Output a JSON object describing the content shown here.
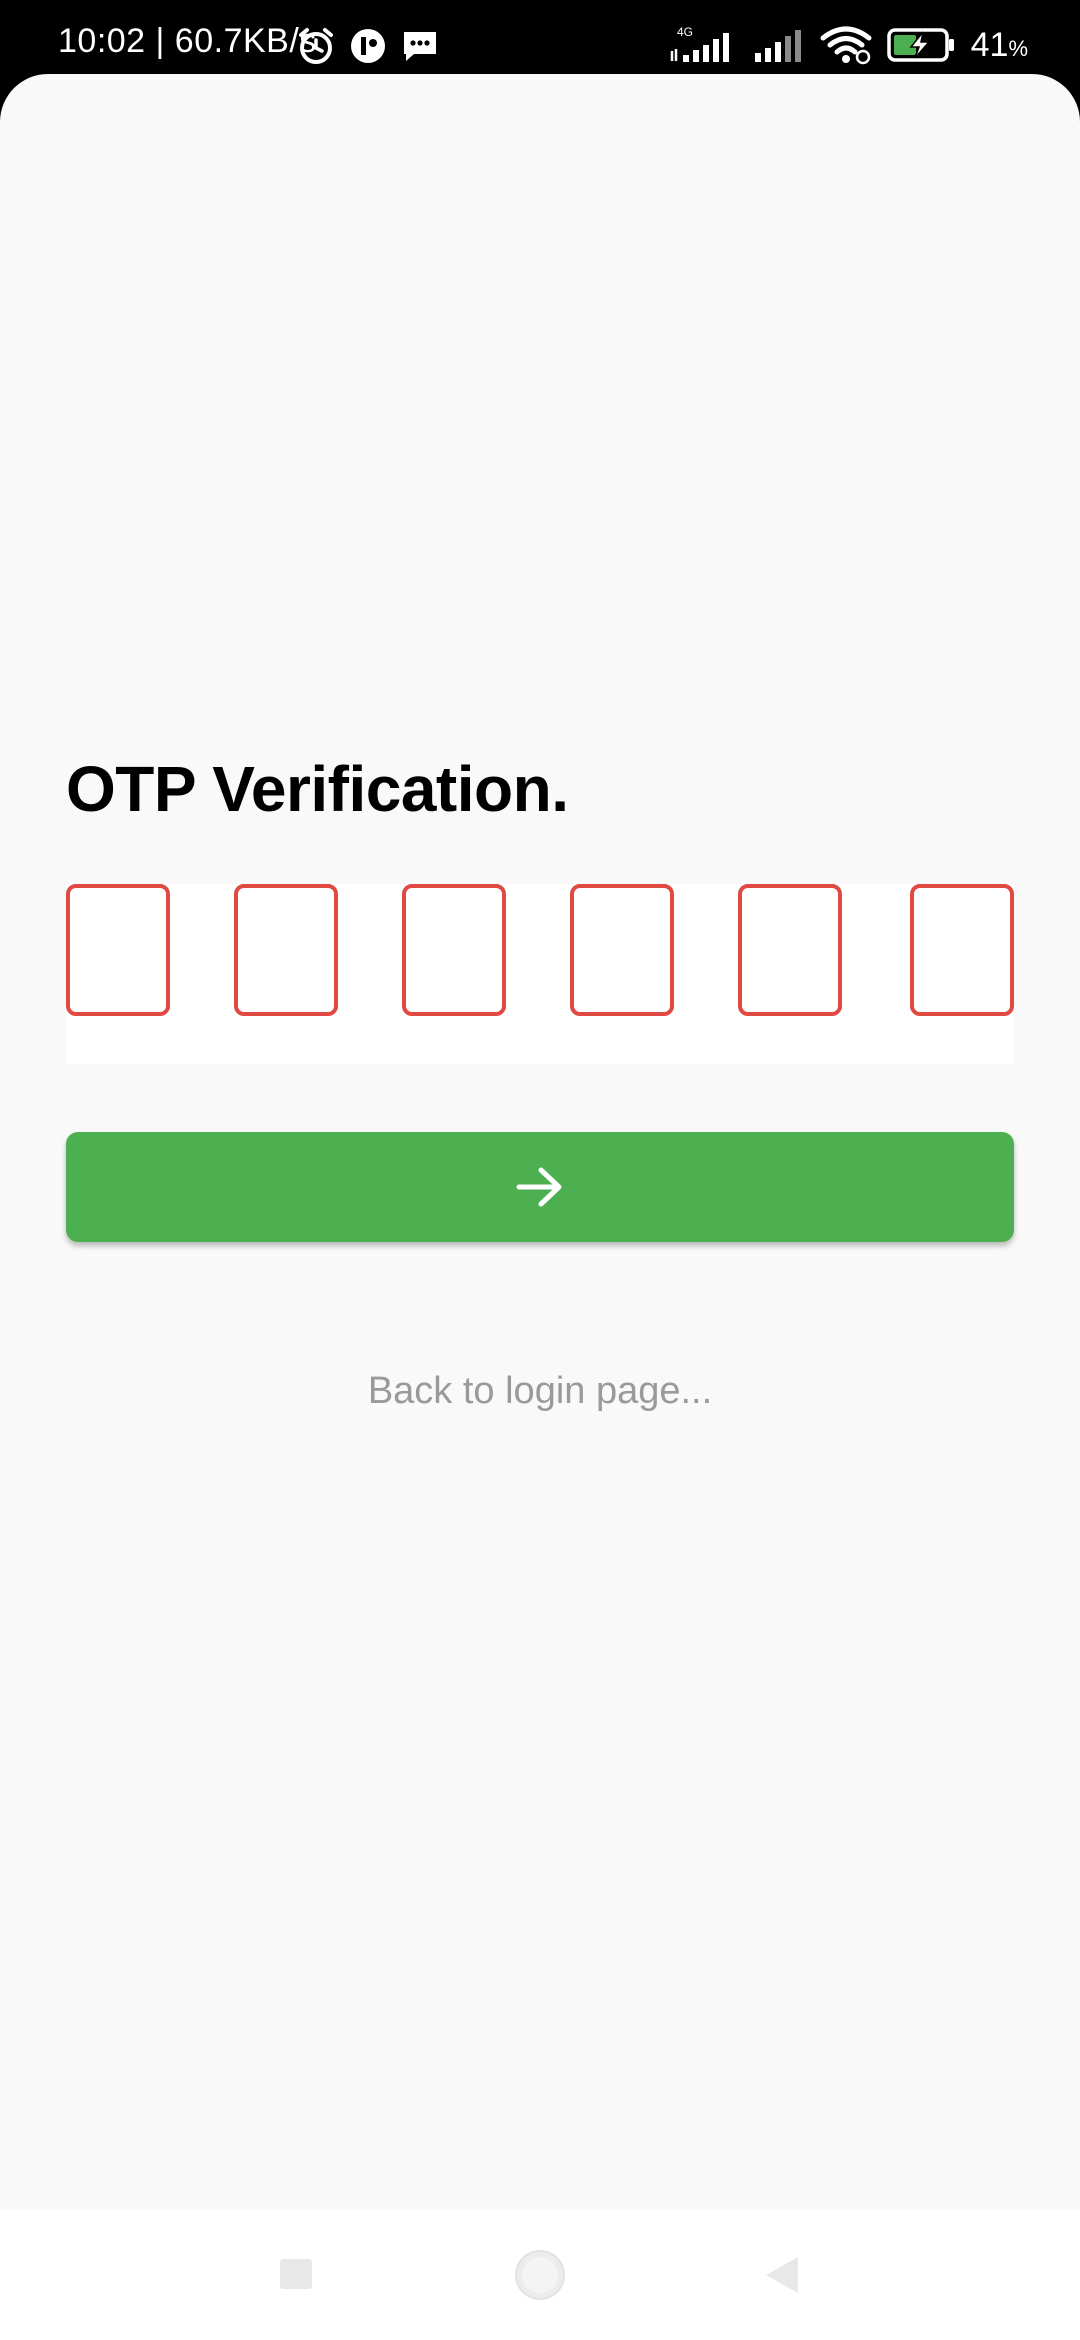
{
  "status_bar": {
    "time_speed": "10:02 | 60.7KB/s",
    "network_label": "4G",
    "battery_percent": "41",
    "battery_unit": "%",
    "icons": [
      "alarm-icon",
      "app-notification-icon",
      "message-icon",
      "signal-4g-icon",
      "signal-icon",
      "wifi-icon",
      "battery-charging-icon"
    ],
    "battery_color": "#4caf50"
  },
  "screen": {
    "title": "OTP Verification.",
    "otp_digits": [
      "",
      "",
      "",
      "",
      "",
      ""
    ],
    "otp_border_color": "#e04a43",
    "submit_button_icon": "arrow-right-icon",
    "submit_button_color": "#4caf50",
    "back_link_label": "Back to login page..."
  },
  "nav_bar": {
    "items": [
      "recents-icon",
      "home-icon",
      "back-icon"
    ]
  }
}
